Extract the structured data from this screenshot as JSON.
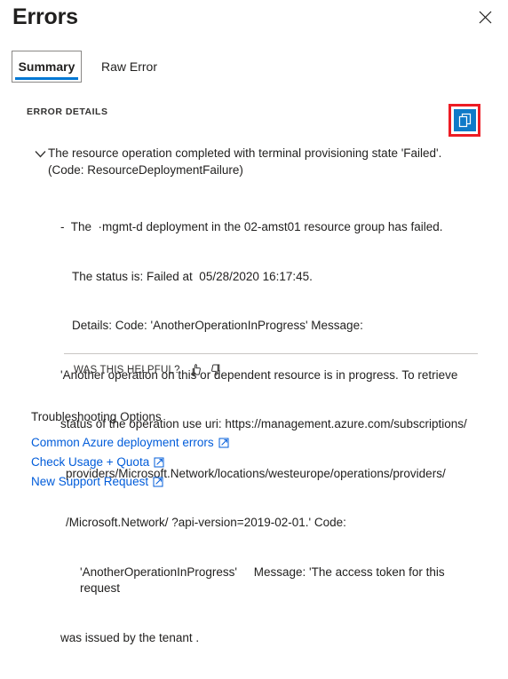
{
  "header": {
    "title": "Errors",
    "close_icon": "close-icon"
  },
  "tabs": [
    {
      "label": "Summary",
      "active": true
    },
    {
      "label": "Raw Error",
      "active": false
    }
  ],
  "error_details": {
    "section_label": "ERROR DETAILS",
    "copy_icon": "copy-icon",
    "copy_highlight_color": "#ed1c24",
    "copy_icon_color": "#0f7ac8",
    "expand_icon": "chevron-down-icon",
    "headline": "The resource operation completed with terminal provisioning state 'Failed'. (Code: ResourceDeploymentFailure)",
    "detail_lines": [
      "-  The  ·mgmt-d deployment in the 02-amst01 resource group has failed.",
      "The status is: Failed at  05/28/2020 16:17:45.",
      "Details: Code: 'AnotherOperationInProgress' Message:",
      "'Another operation on this or dependent resource is in progress. To retrieve",
      "status of the operation use uri: https://management.azure.com/subscriptions/",
      "providers/Microsoft.Network/locations/westeurope/operations/providers/",
      "/Microsoft.Network/ ?api-version=2019-02-01.' Code:",
      "'AnotherOperationInProgress'     Message: 'The access token for this request",
      "was issued by the tenant ."
    ]
  },
  "feedback": {
    "label": "WAS THIS HELPFUL?",
    "thumbs_up_icon": "thumbs-up-icon",
    "thumbs_down_icon": "thumbs-down-icon"
  },
  "troubleshooting": {
    "title": "Troubleshooting Options",
    "links": [
      {
        "label": "Common Azure deployment errors",
        "icon": "external-link-icon"
      },
      {
        "label": "Check Usage + Quota",
        "icon": "external-link-icon"
      },
      {
        "label": "New Support Request",
        "icon": "external-link-icon"
      }
    ],
    "link_color": "#015cda"
  }
}
